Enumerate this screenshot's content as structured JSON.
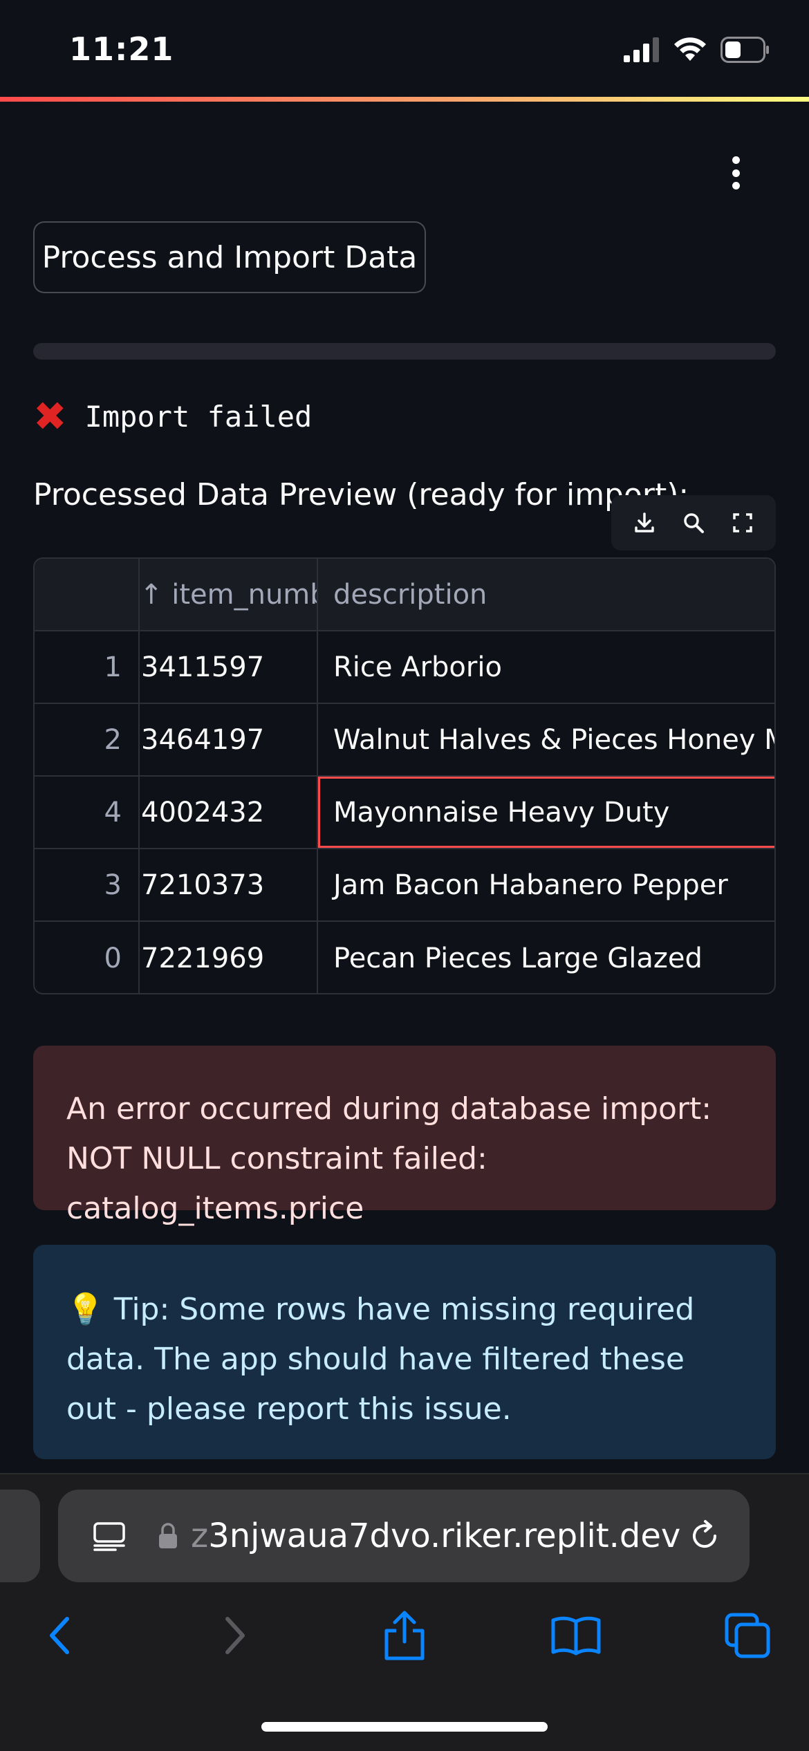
{
  "status_bar": {
    "time": "11:21"
  },
  "app": {
    "process_button_label": "Process and Import Data",
    "progress": 0,
    "import_status": "Import failed",
    "preview_title": "Processed Data Preview (ready for import):",
    "table": {
      "columns": [
        "",
        "↑ item_number",
        "description"
      ],
      "rows": [
        {
          "index": "1",
          "item_number": "3411597",
          "description": "Rice Arborio"
        },
        {
          "index": "2",
          "item_number": "3464197",
          "description": "Walnut Halves & Pieces Honey Maple"
        },
        {
          "index": "4",
          "item_number": "4002432",
          "description": "Mayonnaise Heavy Duty"
        },
        {
          "index": "3",
          "item_number": "7210373",
          "description": "Jam Bacon Habanero Pepper"
        },
        {
          "index": "0",
          "item_number": "7221969",
          "description": "Pecan Pieces Large Glazed"
        }
      ]
    },
    "error_message": "An error occurred during database import: NOT NULL constraint failed: catalog_items.price",
    "tip_icon": "💡",
    "tip_message": "Tip: Some rows have missing required data. The app should have filtered these out - please report this issue.",
    "icons": [
      "menu-dots-icon",
      "download-icon",
      "search-icon",
      "fullscreen-icon",
      "error-x-icon",
      "lightbulb-icon"
    ]
  },
  "browser": {
    "url_prefix": "z",
    "url_rest": "3njwaua7dvo.riker.replit.dev",
    "icons": [
      "reader-icon",
      "lock-icon",
      "reload-icon",
      "back-icon",
      "forward-icon",
      "share-icon",
      "bookmarks-icon",
      "tabs-icon"
    ]
  },
  "colors": {
    "background": "#0e1117",
    "accent_red": "#ff4b4b",
    "error_bg": "#3e2428",
    "info_bg": "#172d43",
    "ios_blue": "#0a84ff"
  }
}
